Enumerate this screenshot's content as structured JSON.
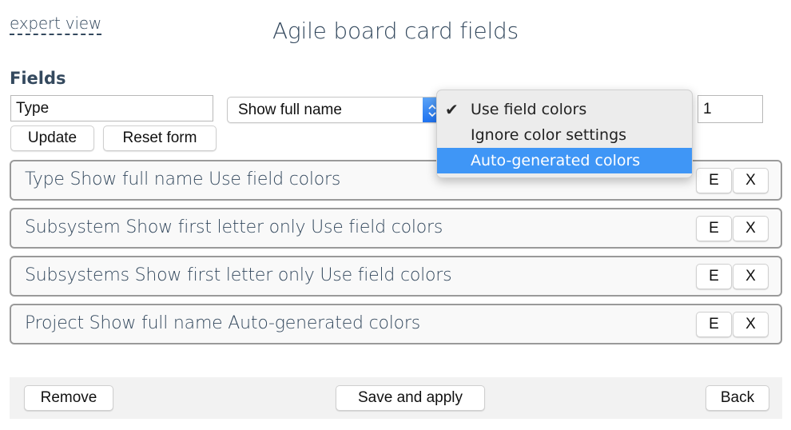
{
  "header": {
    "expert_link": "expert view",
    "title": "Agile board card fields"
  },
  "form": {
    "section_heading": "Fields",
    "field_name_value": "Type",
    "display_mode_selected": "Show full name",
    "order_value": "1",
    "update_label": "Update",
    "reset_label": "Reset form",
    "color_dropdown": {
      "selected": "Use field colors",
      "options": [
        {
          "label": "Use field colors",
          "checked": true,
          "highlighted": false
        },
        {
          "label": "Ignore color settings",
          "checked": false,
          "highlighted": false
        },
        {
          "label": "Auto-generated colors",
          "checked": false,
          "highlighted": true
        }
      ],
      "check_icon": "✔"
    }
  },
  "field_rows": [
    {
      "text": "Type Show full name Use field colors",
      "edit_label": "E",
      "delete_label": "X"
    },
    {
      "text": "Subsystem Show first letter only Use field colors",
      "edit_label": "E",
      "delete_label": "X"
    },
    {
      "text": "Subsystems Show first letter only Use field colors",
      "edit_label": "E",
      "delete_label": "X"
    },
    {
      "text": "Project Show full name Auto-generated colors",
      "edit_label": "E",
      "delete_label": "X"
    }
  ],
  "footer": {
    "remove_label": "Remove",
    "save_label": "Save and apply",
    "back_label": "Back"
  },
  "colors": {
    "text_primary": "#34495e",
    "highlight": "#3f96f6",
    "select_arrow": "#1a6ff0",
    "footer_bg": "#f2f2f2"
  }
}
